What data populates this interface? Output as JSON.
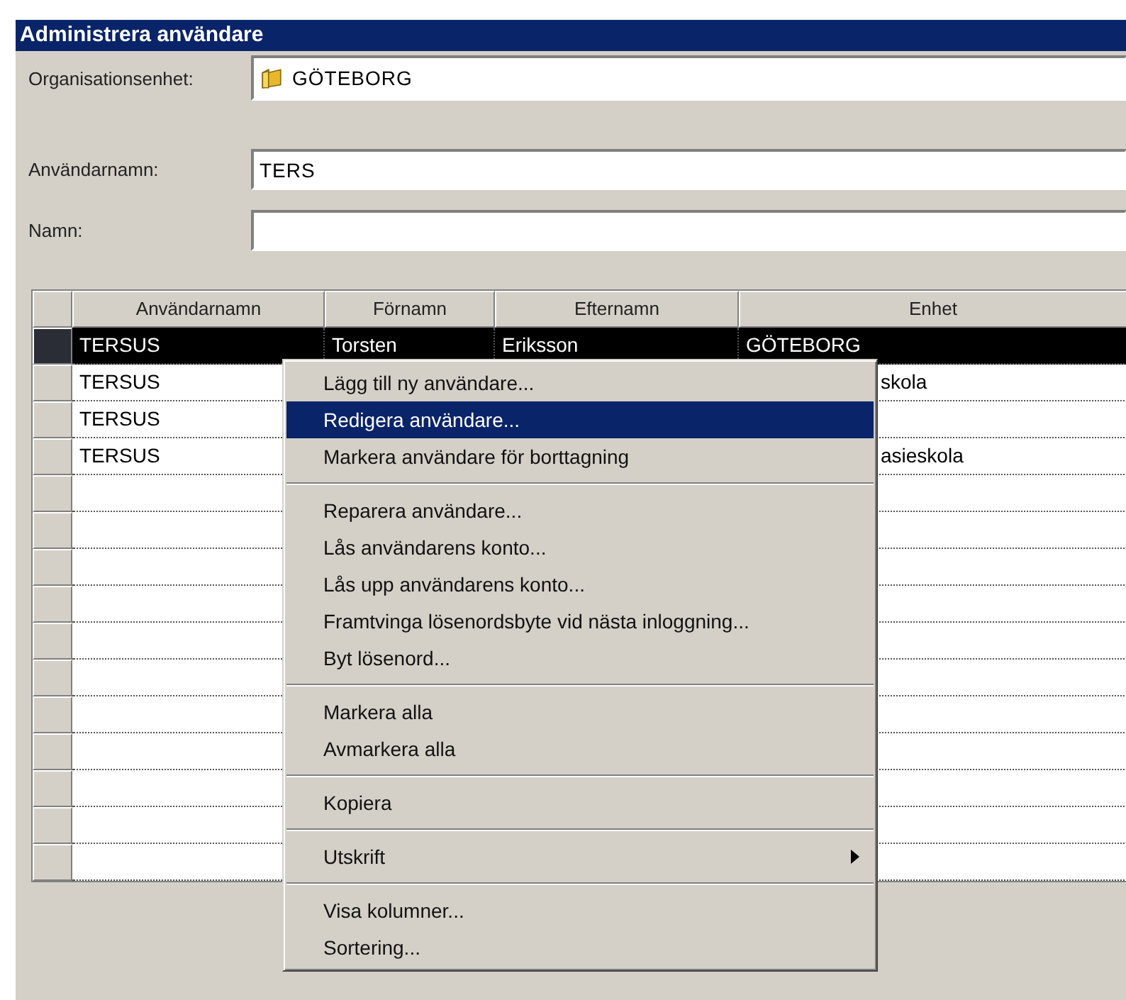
{
  "window": {
    "title": "Administrera användare"
  },
  "fields": [
    {
      "label": "Organisationsenhet:",
      "value": "GÖTEBORG",
      "kind": "folder"
    },
    {
      "label": "Användarnamn:",
      "value": "TERS",
      "kind": "text"
    },
    {
      "label": "Namn:",
      "kind": "text"
    }
  ],
  "table": {
    "columns": [
      "Användarnamn",
      "Förnamn",
      "Efternamn",
      "Enhet"
    ],
    "rows": [
      {
        "selected": true,
        "cells": [
          "TERSUS",
          "Torsten",
          "Eriksson",
          "GÖTEBORG"
        ]
      },
      {
        "selected": false,
        "cells": [
          "TERSUS",
          null,
          null,
          "skola"
        ]
      },
      {
        "selected": false,
        "cells": [
          "TERSUS",
          null,
          null,
          null
        ]
      },
      {
        "selected": false,
        "cells": [
          "TERSUS",
          null,
          null,
          "asieskola"
        ]
      }
    ]
  },
  "context_menu": {
    "items": [
      {
        "kind": "item",
        "label": "Lägg till ny användare...",
        "selected": false
      },
      {
        "kind": "item",
        "label": "Redigera användare...",
        "selected": true
      },
      {
        "kind": "item",
        "label": "Markera användare för borttagning",
        "selected": false
      },
      {
        "kind": "separator"
      },
      {
        "kind": "item",
        "label": "Reparera användare...",
        "selected": false
      },
      {
        "kind": "item",
        "label": "Lås användarens konto...",
        "selected": false
      },
      {
        "kind": "item",
        "label": "Lås upp användarens konto...",
        "selected": false
      },
      {
        "kind": "item",
        "label": "Framtvinga lösenordsbyte vid nästa inloggning...",
        "selected": false
      },
      {
        "kind": "item",
        "label": "Byt lösenord...",
        "selected": false
      },
      {
        "kind": "separator"
      },
      {
        "kind": "item",
        "label": "Markera alla",
        "selected": false
      },
      {
        "kind": "item",
        "label": "Avmarkera alla",
        "selected": false
      },
      {
        "kind": "separator"
      },
      {
        "kind": "item",
        "label": "Kopiera",
        "selected": false
      },
      {
        "kind": "separator"
      },
      {
        "kind": "submenu",
        "label": "Utskrift",
        "selected": false
      },
      {
        "kind": "separator"
      },
      {
        "kind": "item",
        "label": "Visa kolumner...",
        "selected": false
      },
      {
        "kind": "item",
        "label": "Sortering...",
        "selected": false
      }
    ]
  }
}
